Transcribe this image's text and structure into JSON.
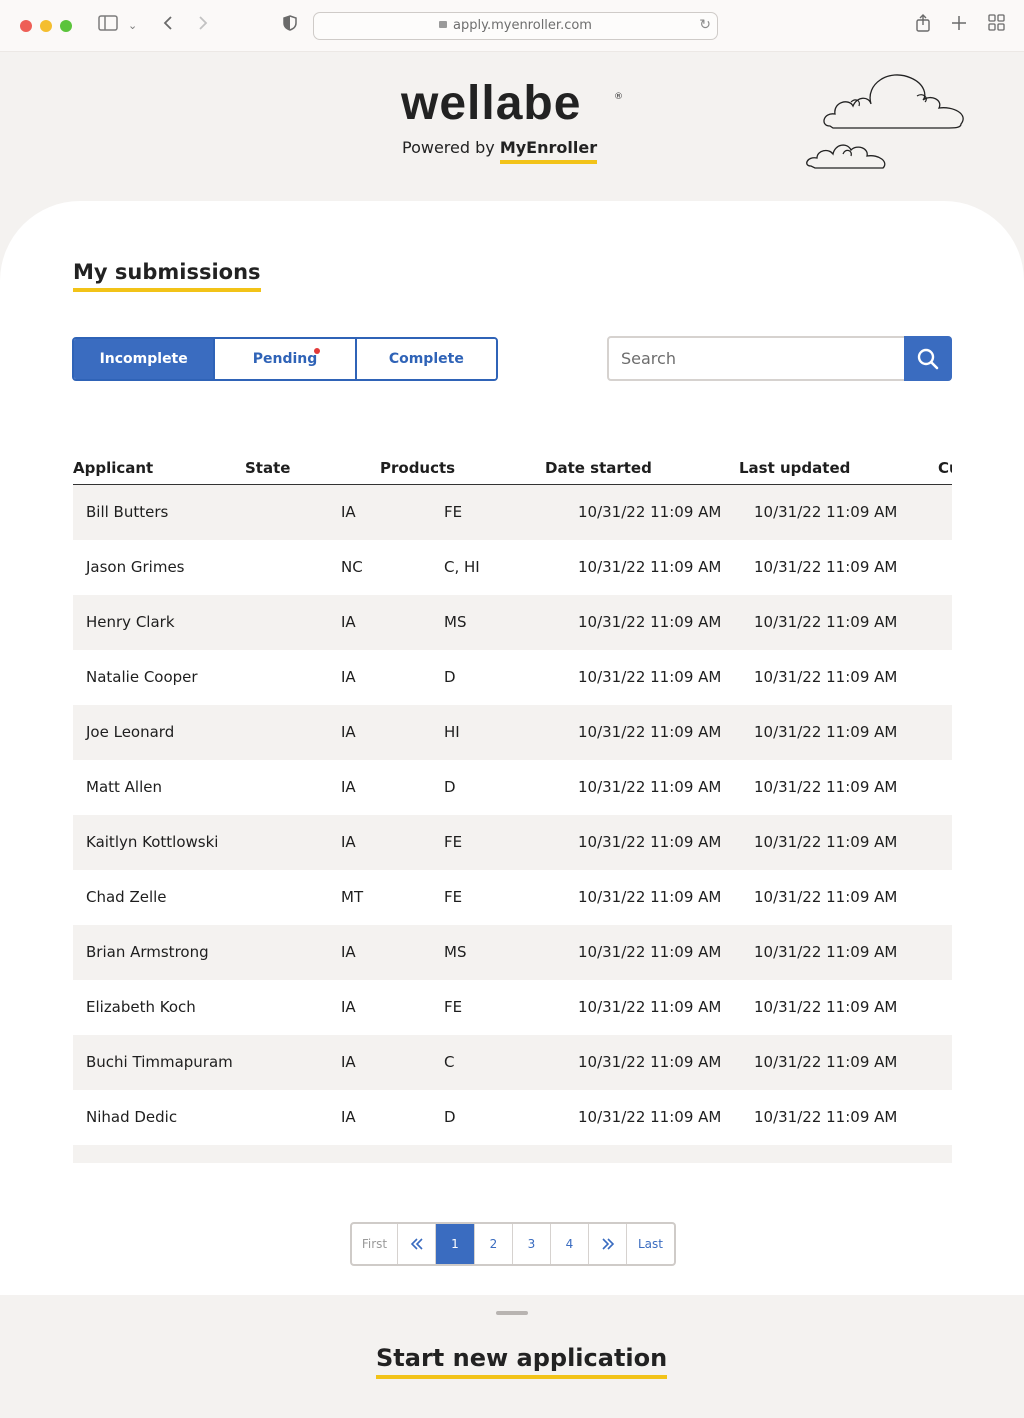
{
  "browser": {
    "url": "apply.myenroller.com"
  },
  "brand": {
    "logo_text": "wellabe",
    "registered": "®",
    "powered_prefix": "Powered by",
    "powered_brand": "MyEnroller",
    "accent_color": "#f2c318",
    "primary_color": "#3a6cc0"
  },
  "page": {
    "title": "My submissions"
  },
  "tabs": [
    {
      "label": "Incomplete",
      "active": true
    },
    {
      "label": "Pending",
      "active": false,
      "has_notification": true
    },
    {
      "label": "Complete",
      "active": false
    }
  ],
  "search": {
    "placeholder": "Search"
  },
  "table": {
    "columns": [
      "Applicant",
      "State",
      "Products",
      "Date started",
      "Last updated",
      "Cu"
    ],
    "rows": [
      {
        "applicant": "Bill Butters",
        "state": "IA",
        "products": "FE",
        "date_started": "10/31/22 11:09 AM",
        "last_updated": "10/31/22 11:09 AM"
      },
      {
        "applicant": "Jason Grimes",
        "state": "NC",
        "products": "C, HI",
        "date_started": "10/31/22 11:09 AM",
        "last_updated": "10/31/22 11:09 AM"
      },
      {
        "applicant": "Henry Clark",
        "state": "IA",
        "products": "MS",
        "date_started": "10/31/22 11:09 AM",
        "last_updated": "10/31/22 11:09 AM"
      },
      {
        "applicant": "Natalie Cooper",
        "state": "IA",
        "products": "D",
        "date_started": "10/31/22 11:09 AM",
        "last_updated": "10/31/22 11:09 AM"
      },
      {
        "applicant": "Joe Leonard",
        "state": "IA",
        "products": "HI",
        "date_started": "10/31/22 11:09 AM",
        "last_updated": "10/31/22 11:09 AM"
      },
      {
        "applicant": "Matt Allen",
        "state": "IA",
        "products": "D",
        "date_started": "10/31/22 11:09 AM",
        "last_updated": "10/31/22 11:09 AM"
      },
      {
        "applicant": "Kaitlyn Kottlowski",
        "state": "IA",
        "products": "FE",
        "date_started": "10/31/22 11:09 AM",
        "last_updated": "10/31/22 11:09 AM"
      },
      {
        "applicant": "Chad Zelle",
        "state": "MT",
        "products": "FE",
        "date_started": "10/31/22 11:09 AM",
        "last_updated": "10/31/22 11:09 AM"
      },
      {
        "applicant": "Brian Armstrong",
        "state": "IA",
        "products": "MS",
        "date_started": "10/31/22 11:09 AM",
        "last_updated": "10/31/22 11:09 AM"
      },
      {
        "applicant": "Elizabeth Koch",
        "state": "IA",
        "products": "FE",
        "date_started": "10/31/22 11:09 AM",
        "last_updated": "10/31/22 11:09 AM"
      },
      {
        "applicant": "Buchi Timmapuram",
        "state": "IA",
        "products": "C",
        "date_started": "10/31/22 11:09 AM",
        "last_updated": "10/31/22 11:09 AM"
      },
      {
        "applicant": "Nihad Dedic",
        "state": "IA",
        "products": "D",
        "date_started": "10/31/22 11:09 AM",
        "last_updated": "10/31/22 11:09 AM"
      },
      {
        "applicant": "",
        "state": "",
        "products": "",
        "date_started": "",
        "last_updated": ""
      }
    ]
  },
  "pagination": {
    "first": "First",
    "prev_icon": "double-chevron-left-icon",
    "pages": [
      "1",
      "2",
      "3",
      "4"
    ],
    "current": "1",
    "next_icon": "double-chevron-right-icon",
    "last": "Last"
  },
  "bottom_sheet": {
    "title": "Start new application"
  }
}
